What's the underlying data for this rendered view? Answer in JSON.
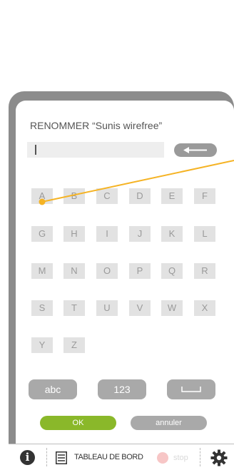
{
  "dialog": {
    "title": "RENOMMER “Sunis wirefree”",
    "input_value": ""
  },
  "keyboard": {
    "rows": [
      [
        "A",
        "B",
        "C",
        "D",
        "E",
        "F"
      ],
      [
        "G",
        "H",
        "I",
        "J",
        "K",
        "L"
      ],
      [
        "M",
        "N",
        "O",
        "P",
        "Q",
        "R"
      ],
      [
        "S",
        "T",
        "U",
        "V",
        "W",
        "X"
      ],
      [
        "Y",
        "Z"
      ]
    ],
    "modes": {
      "abc": "abc",
      "num": "123"
    }
  },
  "actions": {
    "ok": "OK",
    "cancel": "annuler"
  },
  "bottom_bar": {
    "dashboard": "TABLEAU DE BORD",
    "stop": "stop"
  },
  "colors": {
    "accent": "#8ab82a",
    "pointer": "#f5b324",
    "frame": "#8c8c8c",
    "stop": "#f7c6c6"
  }
}
